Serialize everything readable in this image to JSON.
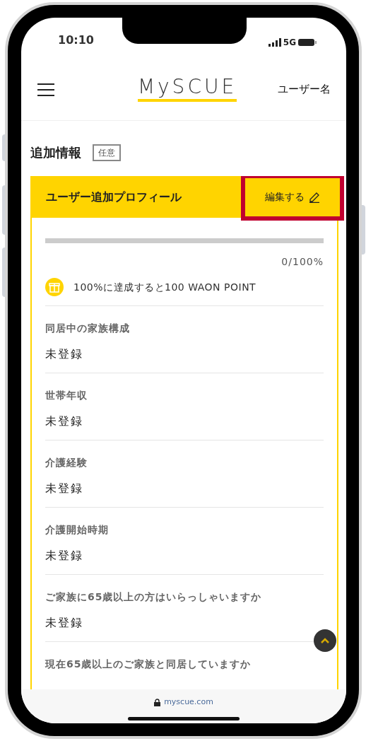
{
  "status_bar": {
    "time": "10:10",
    "network": "5G"
  },
  "header": {
    "logo": "MySCUE",
    "user_name": "ユーザー名"
  },
  "section": {
    "title": "追加情報",
    "badge": "任意"
  },
  "card": {
    "title": "ユーザー追加プロフィール",
    "edit_button": "編集する",
    "edit_highlighted": true,
    "progress": {
      "level": 0,
      "reading": "0/100%"
    },
    "reward": "100%に達成すると100 WAON POINT",
    "fields": [
      {
        "label": "同居中の家族構成",
        "value": "未登録"
      },
      {
        "label": "世帯年収",
        "value": "未登録"
      },
      {
        "label": "介護経験",
        "value": "未登録"
      },
      {
        "label": "介護開始時期",
        "value": "未登録"
      },
      {
        "label": "ご家族に65歳以上の方はいらっしゃいますか",
        "value": "未登録"
      },
      {
        "label": "現在65歳以上のご家族と同居していますか"
      }
    ]
  },
  "address_bar": {
    "url": "myscue.com"
  }
}
